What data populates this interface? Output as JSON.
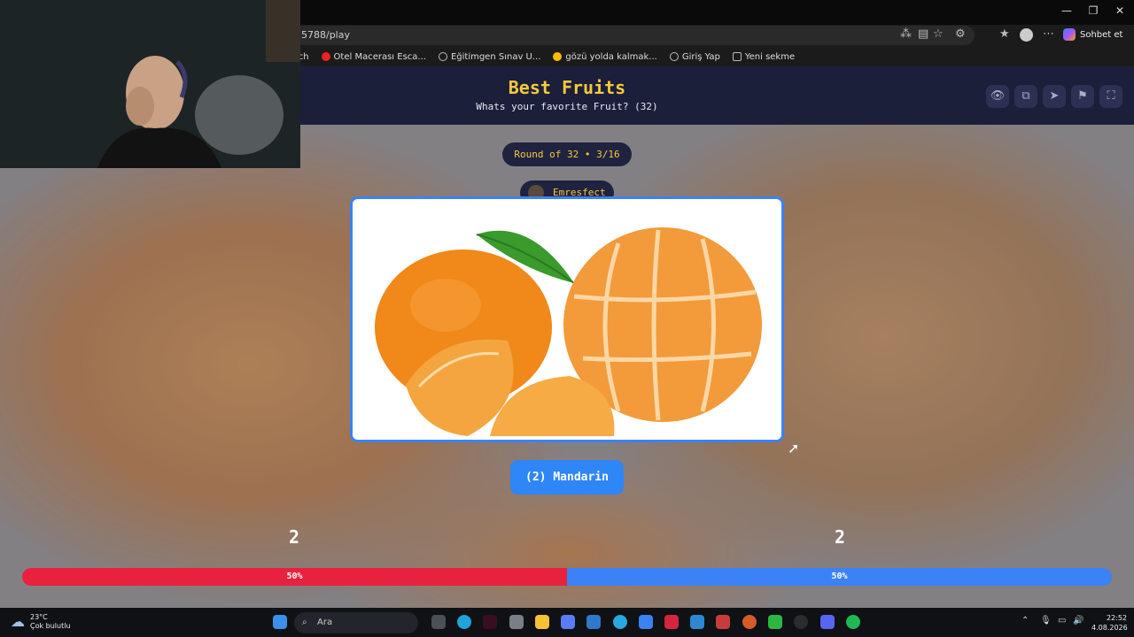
{
  "browser": {
    "address": "5788/play",
    "bookmarks": [
      "itch",
      "Otel Macerası Esca...",
      "Eğitimgen Sınav U...",
      "gözü yolda kalmak...",
      "Giriş Yap",
      "Yeni sekme"
    ],
    "copilot_label": "Sohbet et"
  },
  "header": {
    "title": "Best Fruits",
    "subtitle": "Whats your favorite Fruit? (32)"
  },
  "round": {
    "label": "Round of 32 • 3/16"
  },
  "user": {
    "name": "Emresfect"
  },
  "choice": {
    "label": "(2) Mandarin"
  },
  "scores": {
    "left": "2",
    "right": "2"
  },
  "vote_bar": {
    "left_pct": 50,
    "right_pct": 50,
    "left_label": "50%",
    "right_label": "50%"
  },
  "taskbar": {
    "temperature": "23°C",
    "weather": "Çok bulutlu",
    "search_placeholder": "Ara",
    "time": "22:52",
    "date": "4.08.2026"
  },
  "colors": {
    "accent": "#3b82f6",
    "title": "#f5c93b",
    "left_bar": "#e8213f",
    "header_bg": "#1c1f3a"
  }
}
